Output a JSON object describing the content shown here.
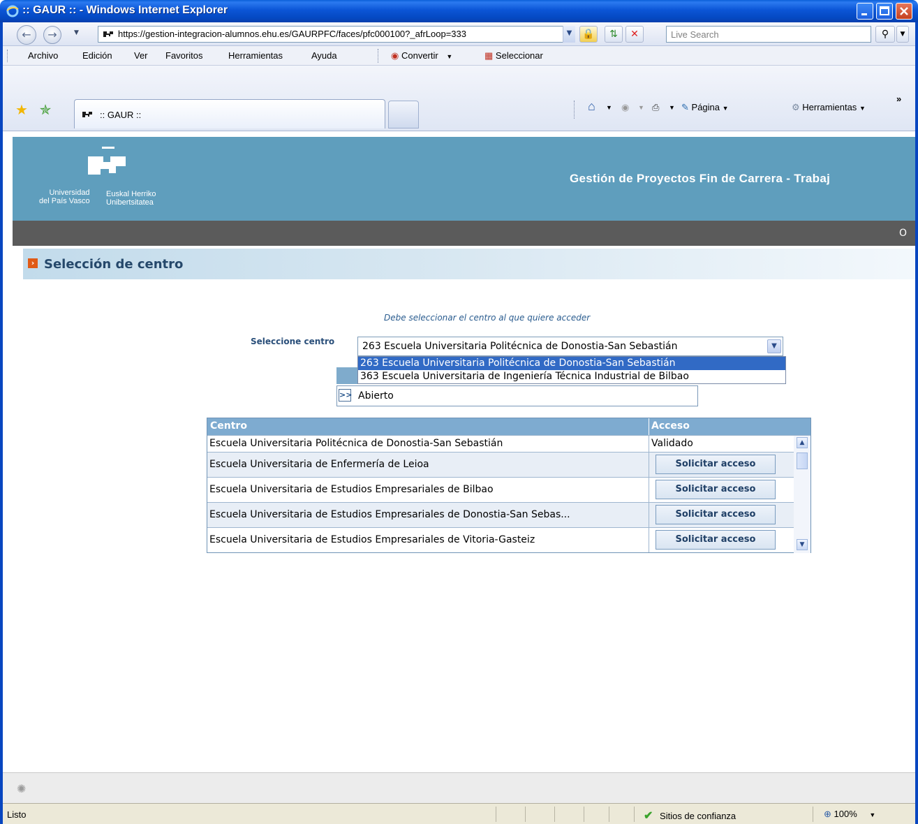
{
  "window": {
    "title": ":: GAUR :: - Windows Internet Explorer"
  },
  "address_bar": {
    "url": "https://gestion-integracion-alumnos.ehu.es/GAURPFC/faces/pfc000100?_afrLoop=333",
    "search_placeholder": "Live Search"
  },
  "menu": {
    "items": [
      "Archivo",
      "Edición",
      "Ver",
      "Favoritos",
      "Herramientas",
      "Ayuda"
    ],
    "convert": "Convertir",
    "select": "Seleccionar"
  },
  "tabs": {
    "active_label": ":: GAUR ::"
  },
  "command_bar": {
    "page": "Página",
    "tools": "Herramientas"
  },
  "banner": {
    "logo_left": "Universidad\ndel País Vasco",
    "logo_right": "Euskal Herriko\nUnibertsitatea",
    "app_title": "Gestión de Proyectos Fin de Carrera - Trabaj",
    "graybar_text": "O"
  },
  "page": {
    "section_title": "Selección de centro",
    "hint": "Debe seleccionar el centro al que quiere acceder",
    "select_label": "Seleccione centro",
    "select_value": "263 Escuela Universitaria Politécnica de Donostia-San Sebastián",
    "options": [
      "263 Escuela Universitaria Politécnica de Donostia-San Sebastián",
      "363 Escuela Universitaria de Ingeniería Técnica Industrial de Bilbao"
    ],
    "status_button": ">>",
    "status_text": "Abierto"
  },
  "grid": {
    "headers": [
      "Centro",
      "Acceso"
    ],
    "rows": [
      {
        "centro": "Escuela Universitaria Politécnica de Donostia-San Sebastián",
        "acceso": "Validado"
      },
      {
        "centro": "Escuela Universitaria de Enfermería de Leioa",
        "acceso": "Solicitar acceso"
      },
      {
        "centro": "Escuela Universitaria de Estudios Empresariales de Bilbao",
        "acceso": "Solicitar acceso"
      },
      {
        "centro": "Escuela Universitaria de Estudios Empresariales de Donostia-San Sebas...",
        "acceso": "Solicitar acceso"
      },
      {
        "centro": "Escuela Universitaria de Estudios Empresariales de Vitoria-Gasteiz",
        "acceso": "Solicitar acceso"
      }
    ]
  },
  "status_bar": {
    "status": "Listo",
    "zone": "Sitios de confianza",
    "zoom": "100%"
  },
  "colors": {
    "banner": "#5f9ebd",
    "graybar": "#5b5b5b",
    "grid_header": "#7eabd0",
    "selection": "#316ac5"
  }
}
